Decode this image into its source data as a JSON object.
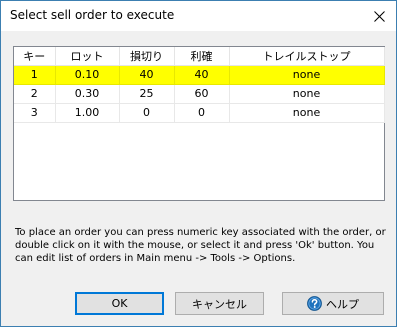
{
  "window": {
    "title": "Select sell order to execute"
  },
  "table": {
    "columns": [
      "キー",
      "ロット",
      "損切り",
      "利確",
      "トレイルストップ"
    ],
    "rows": [
      {
        "key": "1",
        "lot": "0.10",
        "stop_loss": "40",
        "take_profit": "40",
        "trailing_stop": "none",
        "selected": true
      },
      {
        "key": "2",
        "lot": "0.30",
        "stop_loss": "25",
        "take_profit": "60",
        "trailing_stop": "none",
        "selected": false
      },
      {
        "key": "3",
        "lot": "1.00",
        "stop_loss": "0",
        "take_profit": "0",
        "trailing_stop": "none",
        "selected": false
      }
    ],
    "selected_row_color": "#ffff00"
  },
  "instructions": "To place an order you can press numeric key associated with the order,  or double click on it with the mouse, or select it and press 'Ok' button. You can edit list of orders in Main menu -> Tools -> Options.",
  "buttons": {
    "ok_label": "OK",
    "cancel_label": "キャンセル",
    "help_label": "ヘルプ",
    "help_icon": "help-question-icon"
  },
  "colors": {
    "accent": "#0078d7",
    "help_icon": "#1e73be"
  }
}
